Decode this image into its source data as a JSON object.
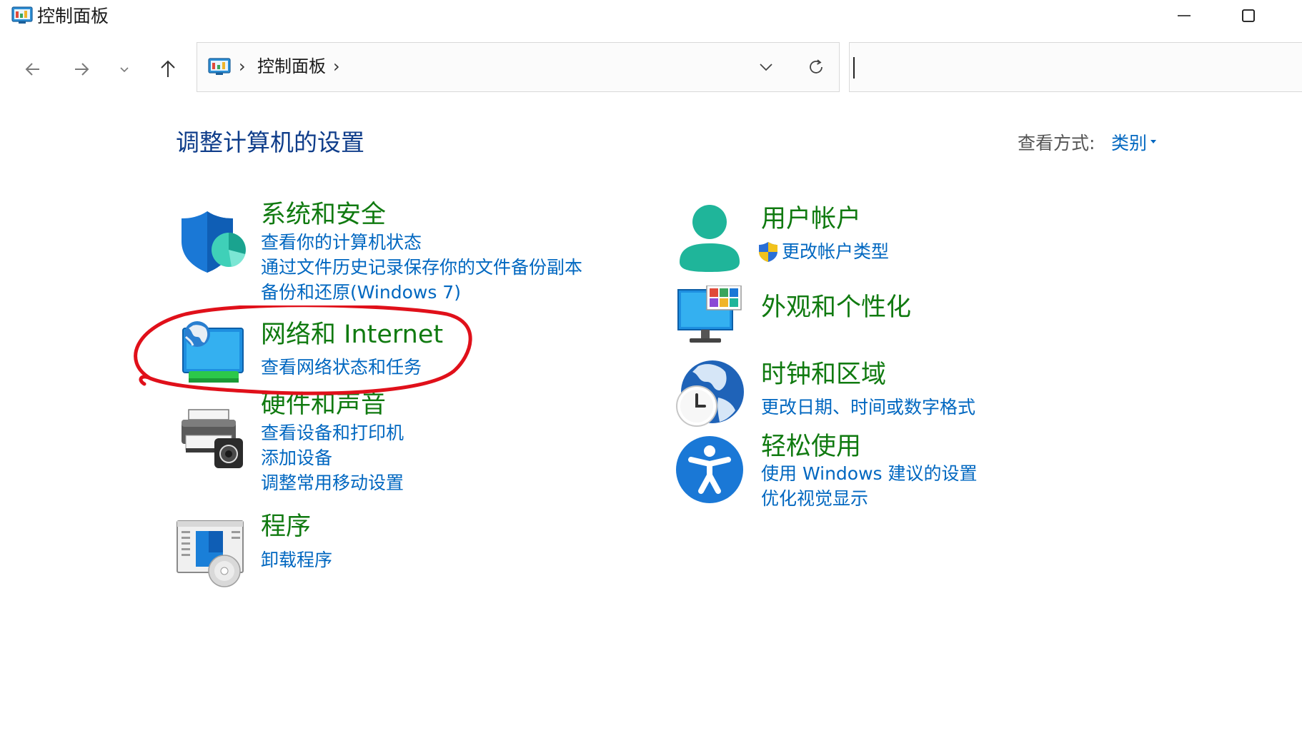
{
  "window": {
    "title": "控制面板"
  },
  "address": {
    "crumb": "控制面板",
    "separator": "›"
  },
  "search": {
    "value": ""
  },
  "page": {
    "title": "调整计算机的设置",
    "view_label": "查看方式:",
    "view_value": "类别"
  },
  "categories": [
    {
      "title": "系统和安全",
      "icon": "shield-icon",
      "links": [
        "查看你的计算机状态",
        "通过文件历史记录保存你的文件备份副本",
        "备份和还原(Windows 7)"
      ]
    },
    {
      "title": "网络和 Internet",
      "icon": "network-globe-icon",
      "links": [
        "查看网络状态和任务"
      ]
    },
    {
      "title": "硬件和声音",
      "icon": "printer-icon",
      "links": [
        "查看设备和打印机",
        "添加设备",
        "调整常用移动设置"
      ]
    },
    {
      "title": "程序",
      "icon": "programs-disc-icon",
      "links": [
        "卸载程序"
      ]
    },
    {
      "title": "用户帐户",
      "icon": "user-icon",
      "links": [
        "更改帐户类型"
      ]
    },
    {
      "title": "外观和个性化",
      "icon": "monitor-tiles-icon",
      "links": []
    },
    {
      "title": "时钟和区域",
      "icon": "clock-globe-icon",
      "links": [
        "更改日期、时间或数字格式"
      ]
    },
    {
      "title": "轻松使用",
      "icon": "accessibility-icon",
      "links": [
        "使用 Windows 建议的设置",
        "优化视觉显示"
      ]
    }
  ],
  "colors": {
    "category_title": "#107a10",
    "link": "#0067c0",
    "page_title": "#0f3d8a",
    "annotation": "#e0101a"
  }
}
